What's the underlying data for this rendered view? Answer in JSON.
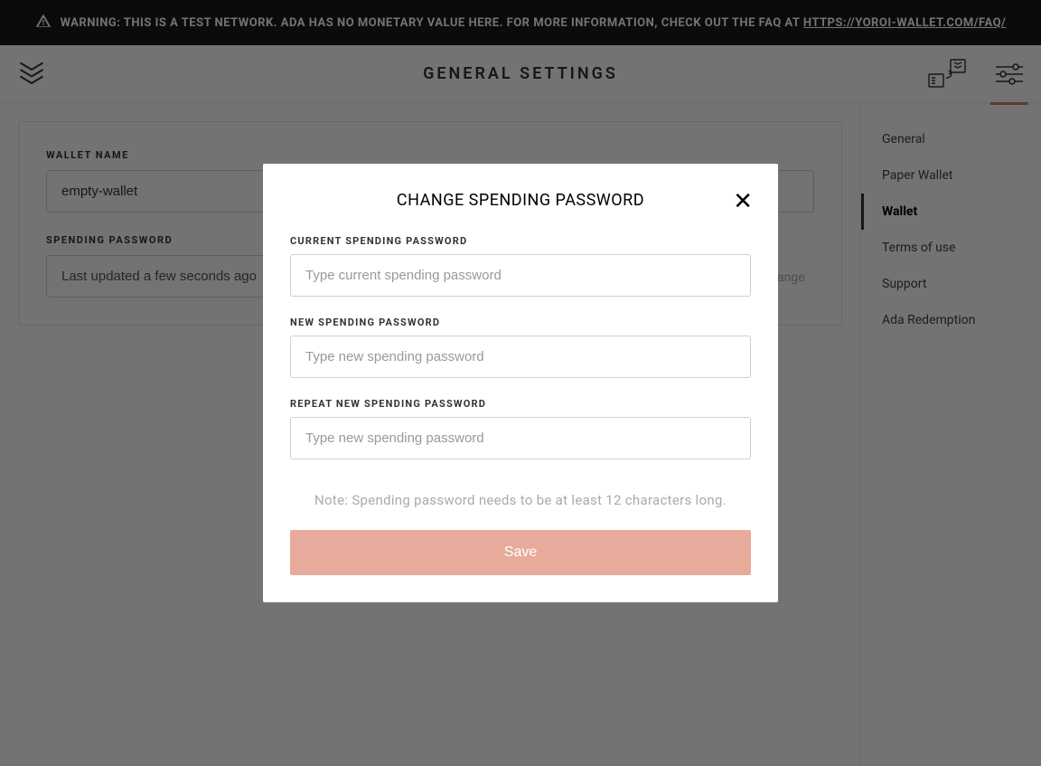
{
  "warning": {
    "text": "WARNING: THIS IS A TEST NETWORK. ADA HAS NO MONETARY VALUE HERE. FOR MORE INFORMATION, CHECK OUT THE FAQ AT ",
    "link_text": "HTTPS://YOROI-WALLET.COM/FAQ/"
  },
  "header": {
    "title": "GENERAL SETTINGS"
  },
  "wallet_settings": {
    "name_label": "WALLET NAME",
    "name_value": "empty-wallet",
    "password_label": "SPENDING PASSWORD",
    "password_value": "Last updated a few seconds ago",
    "change_label": "change"
  },
  "sidebar": {
    "items": [
      {
        "label": "General"
      },
      {
        "label": "Paper Wallet"
      },
      {
        "label": "Wallet"
      },
      {
        "label": "Terms of use"
      },
      {
        "label": "Support"
      },
      {
        "label": "Ada Redemption"
      }
    ]
  },
  "modal": {
    "title": "CHANGE SPENDING PASSWORD",
    "current_label": "CURRENT SPENDING PASSWORD",
    "current_placeholder": "Type current spending password",
    "new_label": "NEW SPENDING PASSWORD",
    "new_placeholder": "Type new spending password",
    "repeat_label": "REPEAT NEW SPENDING PASSWORD",
    "repeat_placeholder": "Type new spending password",
    "note": "Note: Spending password needs to be at least 12 characters long.",
    "save_label": "Save"
  },
  "colors": {
    "accent": "#d4826a",
    "save_btn": "#e8ab9b"
  }
}
